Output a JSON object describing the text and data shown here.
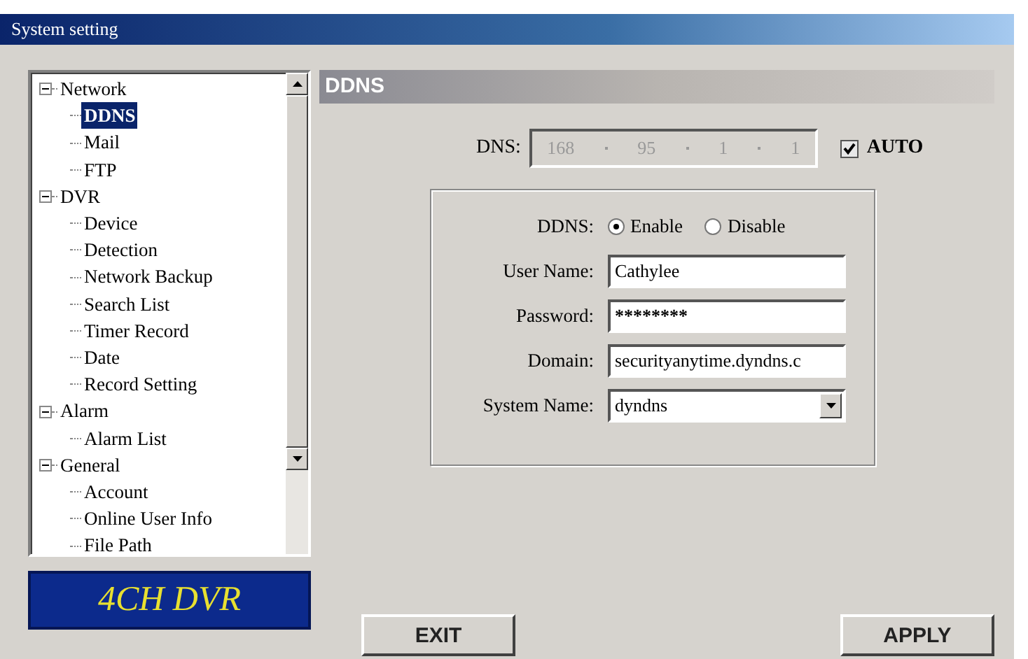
{
  "window": {
    "title": "System setting"
  },
  "tree": [
    {
      "label": "Network",
      "expanded": true,
      "selected": false,
      "children": [
        {
          "label": "DDNS",
          "selected": true
        },
        {
          "label": "Mail",
          "selected": false
        },
        {
          "label": "FTP",
          "selected": false
        }
      ]
    },
    {
      "label": "DVR",
      "expanded": true,
      "selected": false,
      "children": [
        {
          "label": "Device",
          "selected": false
        },
        {
          "label": "Detection",
          "selected": false
        },
        {
          "label": "Network Backup",
          "selected": false
        },
        {
          "label": "Search List",
          "selected": false
        },
        {
          "label": "Timer Record",
          "selected": false
        },
        {
          "label": "Date",
          "selected": false
        },
        {
          "label": "Record Setting",
          "selected": false
        }
      ]
    },
    {
      "label": "Alarm",
      "expanded": true,
      "selected": false,
      "children": [
        {
          "label": "Alarm List",
          "selected": false
        }
      ]
    },
    {
      "label": "General",
      "expanded": true,
      "selected": false,
      "children": [
        {
          "label": "Account",
          "selected": false
        },
        {
          "label": "Online User Info",
          "selected": false
        },
        {
          "label": "File Path",
          "selected": false
        }
      ]
    }
  ],
  "logo": "4CH DVR",
  "panel": {
    "title": "DDNS",
    "dns": {
      "label": "DNS:",
      "octets": [
        "168",
        "95",
        "1",
        "1"
      ],
      "disabled": true
    },
    "auto": {
      "label": "AUTO",
      "checked": true
    },
    "ddns": {
      "label": "DDNS:",
      "options": [
        {
          "label": "Enable",
          "selected": true
        },
        {
          "label": "Disable",
          "selected": false
        }
      ]
    },
    "fields": [
      {
        "kind": "text",
        "label": "User Name:",
        "value": "Cathylee"
      },
      {
        "kind": "password",
        "label": "Password:",
        "value": "********"
      },
      {
        "kind": "text",
        "label": "Domain:",
        "value": "securityanytime.dyndns.c"
      },
      {
        "kind": "select",
        "label": "System Name:",
        "value": "dyndns"
      }
    ]
  },
  "buttons": [
    "EXIT",
    "APPLY"
  ]
}
